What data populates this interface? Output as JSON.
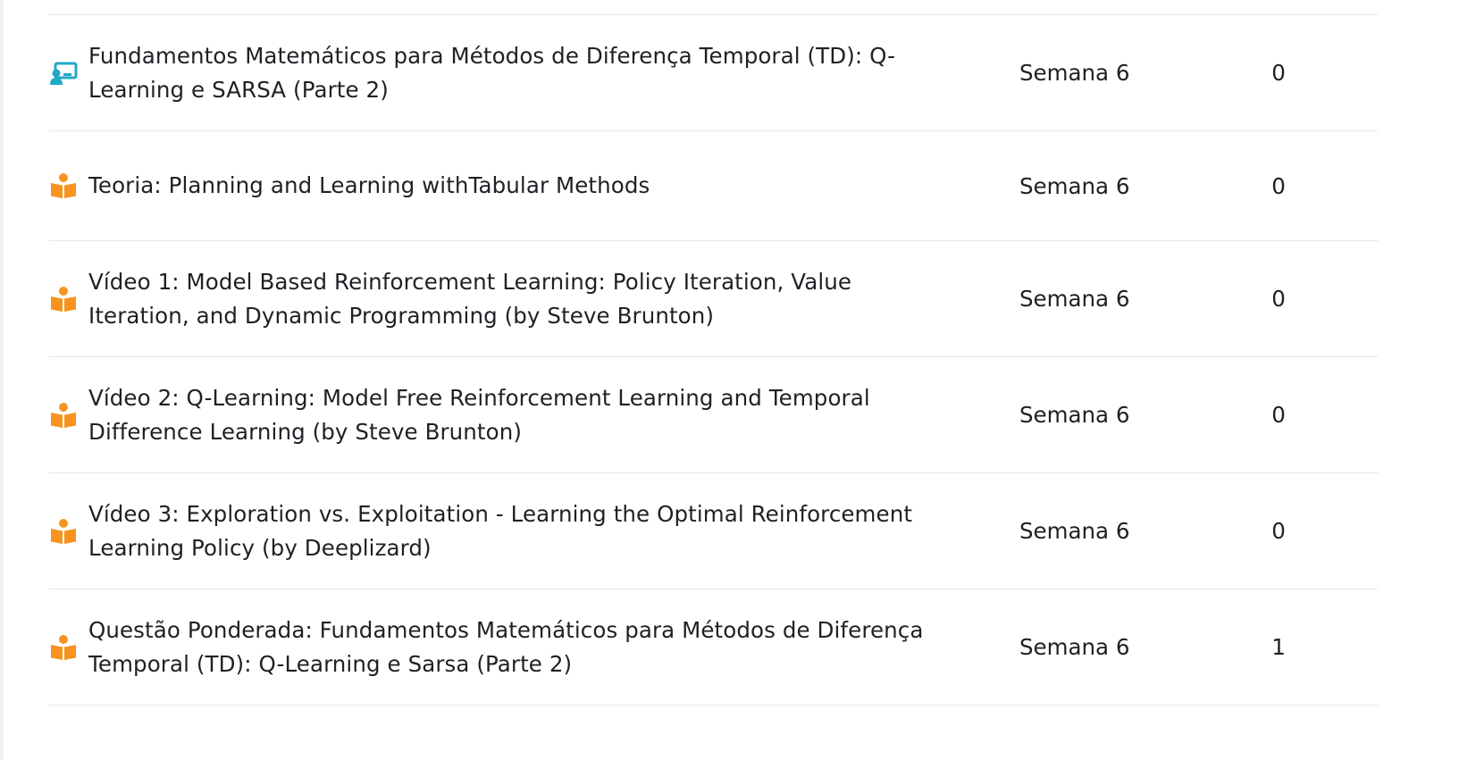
{
  "rows": [
    {
      "icon": "presentation-icon",
      "title": "Fundamentos Matemáticos para Métodos de Diferença Temporal (TD): Q-Learning e SARSA (Parte 2)",
      "week": "Semana 6",
      "count": "0"
    },
    {
      "icon": "book-reader-icon",
      "title": "Teoria: Planning and Learning withTabular Methods",
      "week": "Semana 6",
      "count": "0"
    },
    {
      "icon": "book-reader-icon",
      "title": "Vídeo 1: Model Based Reinforcement Learning: Policy Iteration, Value Iteration, and Dynamic Programming (by Steve Brunton)",
      "week": "Semana 6",
      "count": "0"
    },
    {
      "icon": "book-reader-icon",
      "title": "Vídeo 2: Q-Learning: Model Free Reinforcement Learning and Temporal Difference Learning (by Steve Brunton)",
      "week": "Semana 6",
      "count": "0"
    },
    {
      "icon": "book-reader-icon",
      "title": "Vídeo 3: Exploration vs. Exploitation - Learning the Optimal Reinforcement Learning Policy (by Deeplizard)",
      "week": "Semana 6",
      "count": "0"
    },
    {
      "icon": "book-reader-icon",
      "title": "Questão Ponderada: Fundamentos Matemáticos para Métodos de Diferença Temporal (TD): Q-Learning e Sarsa (Parte 2)",
      "week": "Semana 6",
      "count": "1"
    }
  ],
  "colors": {
    "presentation_icon": "#21a8c8",
    "reader_icon": "#f7931e",
    "text": "#1d2125",
    "divider": "#e4e6e8"
  }
}
